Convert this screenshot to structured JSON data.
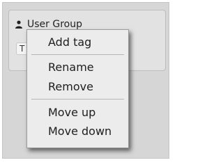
{
  "group": {
    "title": "User Group",
    "icon": "user-icon",
    "tag_chip_text": "T"
  },
  "context_menu": {
    "items": [
      {
        "label": "Add tag"
      },
      {
        "label": "Rename"
      },
      {
        "label": "Remove"
      },
      {
        "label": "Move up"
      },
      {
        "label": "Move down"
      }
    ]
  }
}
